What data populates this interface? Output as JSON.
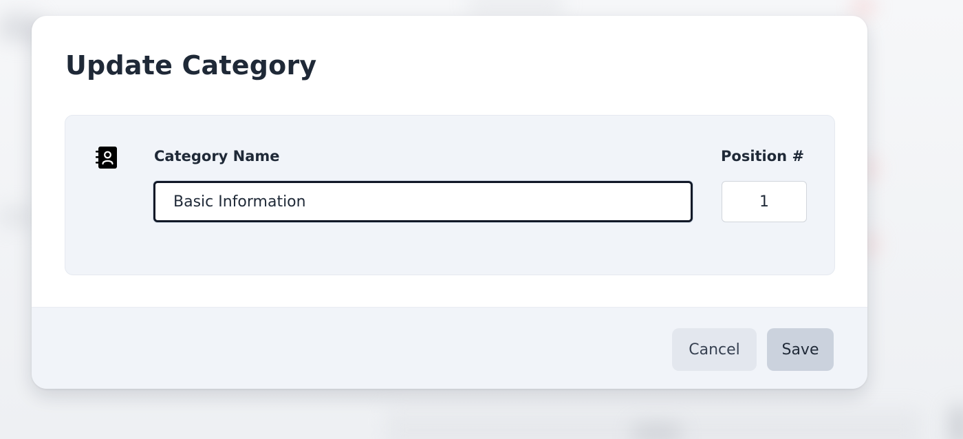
{
  "dialog": {
    "title": "Update Category",
    "icon": "contact-book-icon"
  },
  "form": {
    "category_name_label": "Category Name",
    "category_name_value": "Basic Information",
    "position_label": "Position #",
    "position_value": "1"
  },
  "footer": {
    "cancel_label": "Cancel",
    "save_label": "Save"
  },
  "colors": {
    "title_text": "#1f2937",
    "panel_background": "#f1f4f9",
    "input_focus_border": "#111827",
    "cancel_button": "#e3e7ee",
    "save_button": "#cbd2dd"
  }
}
